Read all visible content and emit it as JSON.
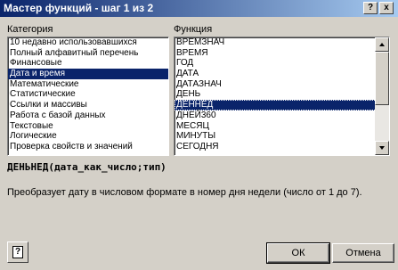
{
  "window": {
    "title": "Мастер функций - шаг 1 из 2"
  },
  "titlebar": {
    "help_label": "?",
    "close_label": "x"
  },
  "category": {
    "label": "Категория",
    "items": [
      "10 недавно использовавшихся",
      "Полный алфавитный перечень",
      "Финансовые",
      "Дата и время",
      "Математические",
      "Статистические",
      "Ссылки и массивы",
      "Работа с базой данных",
      "Текстовые",
      "Логические",
      "Проверка свойств и значений"
    ],
    "selected_index": 3
  },
  "functions": {
    "label": "Функция",
    "items": [
      "ВРЕМЗНАЧ",
      "ВРЕМЯ",
      "ГОД",
      "ДАТА",
      "ДАТАЗНАЧ",
      "ДЕНЬ",
      "ДЕННЕД",
      "ДНЕЙ360",
      "МЕСЯЦ",
      "МИНУТЫ",
      "СЕГОДНЯ"
    ],
    "selected_index": 6
  },
  "signature": "ДЕНЬНЕД(дата_как_число;тип)",
  "description": "Преобразует дату в числовом формате в номер дня недели (число от 1 до 7).",
  "buttons": {
    "ok": "ОК",
    "cancel": "Отмена",
    "help": "?"
  }
}
